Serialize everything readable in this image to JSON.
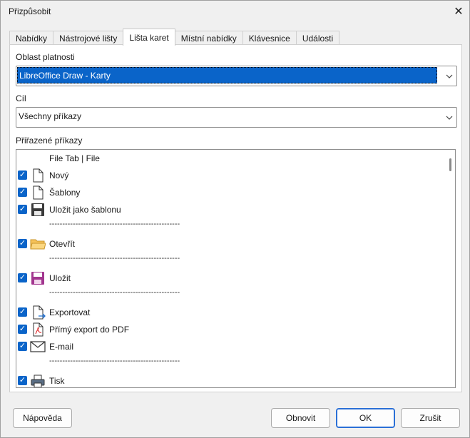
{
  "window": {
    "title": "Přizpůsobit",
    "close_glyph": "✕"
  },
  "tabs": [
    {
      "label": "Nabídky"
    },
    {
      "label": "Nástrojové lišty"
    },
    {
      "label": "Lišta karet"
    },
    {
      "label": "Místní nabídky"
    },
    {
      "label": "Klávesnice"
    },
    {
      "label": "Události"
    }
  ],
  "scope": {
    "label": "Oblast platnosti",
    "value": "LibreOffice Draw -  Karty"
  },
  "target": {
    "label": "Cíl",
    "value": "Všechny příkazy"
  },
  "assigned": {
    "label": "Přiřazené příkazy",
    "items": [
      {
        "text": "File Tab | File"
      },
      {
        "text": "Nový",
        "checked": true,
        "icon": "new-document-icon"
      },
      {
        "text": "Šablony",
        "checked": true,
        "icon": "templates-icon"
      },
      {
        "text": "Uložit jako šablonu",
        "checked": true,
        "icon": "save-as-template-icon"
      },
      {
        "separator": "--------------------------------------------------"
      },
      {
        "text": "Otevřít",
        "checked": true,
        "icon": "open-folder-icon"
      },
      {
        "separator": "--------------------------------------------------"
      },
      {
        "text": "Uložit",
        "checked": true,
        "icon": "save-icon"
      },
      {
        "separator": "--------------------------------------------------"
      },
      {
        "text": "Exportovat",
        "checked": true,
        "icon": "export-icon"
      },
      {
        "text": "Přímý export do PDF",
        "checked": true,
        "icon": "pdf-export-icon"
      },
      {
        "text": "E-mail",
        "checked": true,
        "icon": "email-icon"
      },
      {
        "separator": "--------------------------------------------------"
      },
      {
        "text": "Tisk",
        "checked": true,
        "icon": "print-icon"
      }
    ]
  },
  "buttons": {
    "help": "Nápověda",
    "reset": "Obnovit",
    "ok": "OK",
    "cancel": "Zrušit"
  },
  "colors": {
    "accent": "#0a64c9"
  }
}
